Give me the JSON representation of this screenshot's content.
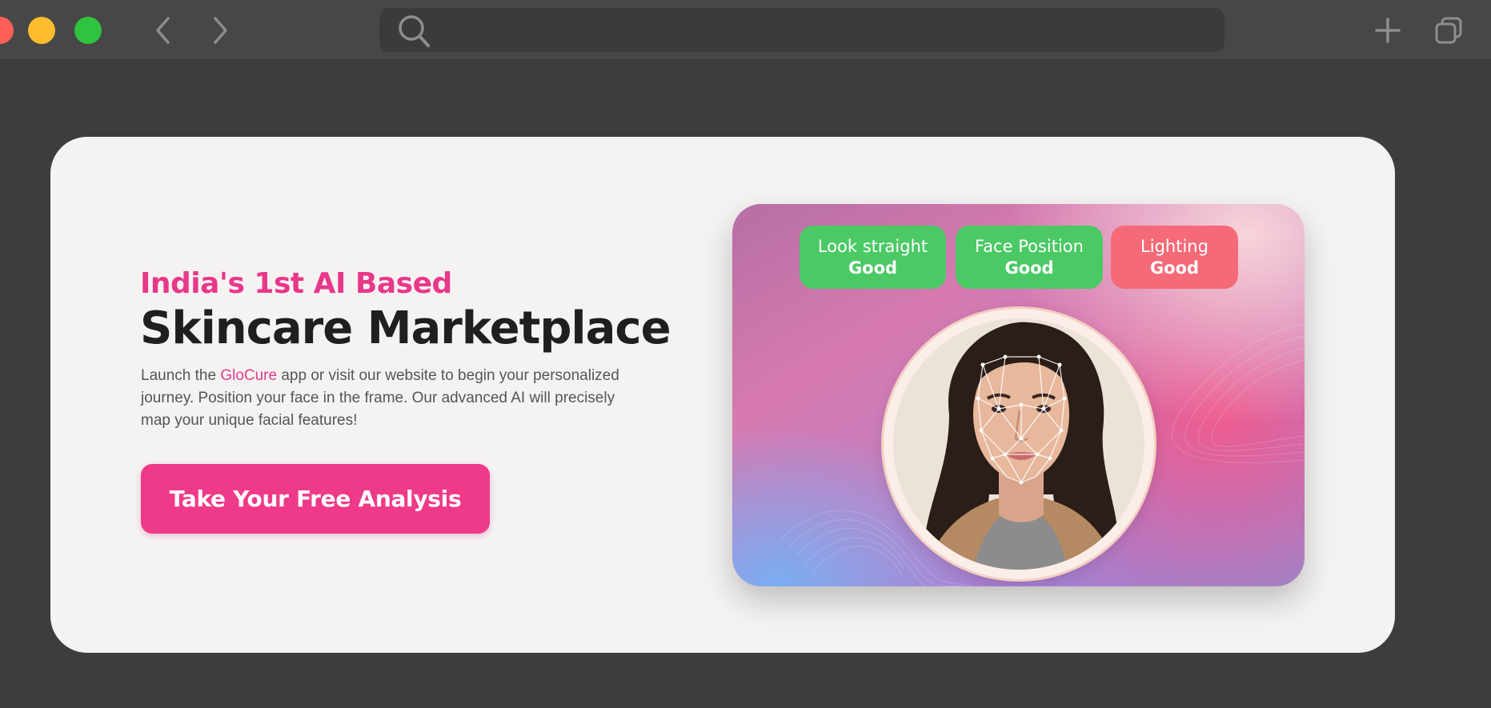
{
  "browser": {
    "back_icon": "chevron-left-icon",
    "forward_icon": "chevron-right-icon",
    "search_icon": "search-icon",
    "address_value": "",
    "new_tab_icon": "plus-icon",
    "tabs_icon": "tab-overview-icon"
  },
  "hero": {
    "kicker": "India's 1st AI Based",
    "headline": "Skincare Marketplace",
    "description_before": "Launch the ",
    "brand": "GloCure",
    "description_after": " app or visit our website to begin your personalized journey. Position your face in the frame. Our advanced AI will precisely map your unique facial features!",
    "cta_label": "Take Your Free Analysis",
    "accent_color": "#ef3a89"
  },
  "scan": {
    "indicators": [
      {
        "label": "Look straight",
        "status": "Good",
        "color": "#4bc965"
      },
      {
        "label": "Face Position",
        "status": "Good",
        "color": "#4bc965"
      },
      {
        "label": "Lighting",
        "status": "Good",
        "color": "#f56a78"
      }
    ]
  }
}
